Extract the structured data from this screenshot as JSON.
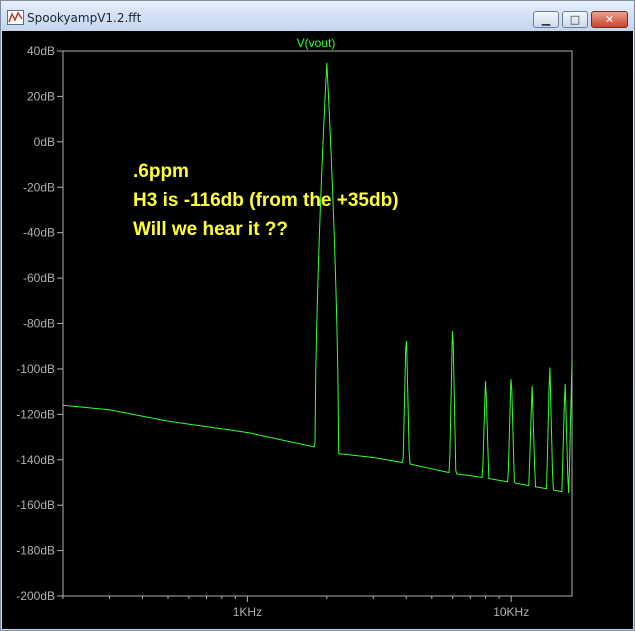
{
  "window": {
    "title": "SpookyampV1.2.fft",
    "minimize_icon": "minimize-icon",
    "maximize_icon": "maximize-icon",
    "close_icon": "close-icon",
    "minimize_glyph": "▁",
    "maximize_glyph": "□",
    "close_glyph": "✕"
  },
  "colors": {
    "background": "#000000",
    "trace": "#33ff33",
    "axis": "#b0b0b0",
    "annotation": "#ffff33"
  },
  "annotation": {
    "line1": ".6ppm",
    "line2": "H3 is -116db (from the +35db)",
    "line3": "Will we hear it ??"
  },
  "chart_data": {
    "type": "line",
    "title": "V(vout)",
    "x_scale": "log",
    "xlim": [
      200,
      17000
    ],
    "ylim": [
      -200,
      40
    ],
    "y_ticks": [
      {
        "value": 40,
        "label": "40dB"
      },
      {
        "value": 20,
        "label": "20dB"
      },
      {
        "value": 0,
        "label": "0dB"
      },
      {
        "value": -20,
        "label": "-20dB"
      },
      {
        "value": -40,
        "label": "-40dB"
      },
      {
        "value": -60,
        "label": "-60dB"
      },
      {
        "value": -80,
        "label": "-80dB"
      },
      {
        "value": -100,
        "label": "-100dB"
      },
      {
        "value": -120,
        "label": "-120dB"
      },
      {
        "value": -140,
        "label": "-140dB"
      },
      {
        "value": -160,
        "label": "-160dB"
      },
      {
        "value": -180,
        "label": "-180dB"
      },
      {
        "value": -200,
        "label": "-200dB"
      }
    ],
    "x_ticks": [
      {
        "value": 1000,
        "label": "1KHz"
      },
      {
        "value": 10000,
        "label": "10KHz"
      }
    ],
    "noise_floor": [
      [
        200,
        -116
      ],
      [
        300,
        -118
      ],
      [
        500,
        -123
      ],
      [
        1000,
        -128
      ],
      [
        1900,
        -135
      ],
      [
        2100,
        -137
      ],
      [
        3000,
        -139
      ],
      [
        4000,
        -141.5
      ],
      [
        5000,
        -144
      ],
      [
        6000,
        -146
      ],
      [
        7000,
        -147
      ],
      [
        8000,
        -148
      ],
      [
        10000,
        -150
      ],
      [
        14000,
        -153
      ],
      [
        17000,
        -155
      ]
    ],
    "peaks": [
      {
        "f": 2000,
        "level": 35
      },
      {
        "f": 4000,
        "level": -81
      },
      {
        "f": 6000,
        "level": -77
      },
      {
        "f": 8000,
        "level": -103
      },
      {
        "f": 10000,
        "level": -100
      },
      {
        "f": 12000,
        "level": -107
      },
      {
        "f": 14000,
        "level": -96
      },
      {
        "f": 16000,
        "level": -104
      },
      {
        "f": 17000,
        "level": -96
      }
    ]
  }
}
